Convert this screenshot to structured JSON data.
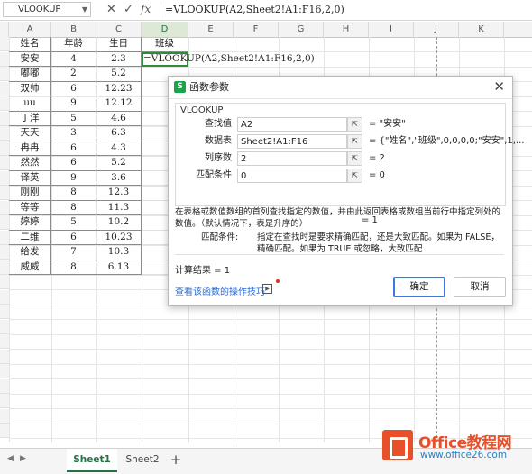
{
  "formula_bar": {
    "name_box": "VLOOKUP",
    "cancel_icon": "✕",
    "accept_icon": "✓",
    "fx_label": "fx",
    "formula": "=VLOOKUP(A2,Sheet2!A1:F16,2,0)"
  },
  "columns": [
    "A",
    "B",
    "C",
    "D",
    "E",
    "F",
    "G",
    "H",
    "I",
    "J",
    "K"
  ],
  "sheet_rows": [
    [
      "姓名",
      "年龄",
      "生日",
      "班级"
    ],
    [
      "安安",
      "4",
      "2.3",
      "=VLOOKUP(A2,Sheet2!A1:F16,2,0)"
    ],
    [
      "嘟嘟",
      "2",
      "5.2",
      ""
    ],
    [
      "双帅",
      "6",
      "12.23",
      ""
    ],
    [
      "uu",
      "9",
      "12.12",
      ""
    ],
    [
      "丁洋",
      "5",
      "4.6",
      ""
    ],
    [
      "天天",
      "3",
      "6.3",
      ""
    ],
    [
      "冉冉",
      "6",
      "4.3",
      ""
    ],
    [
      "然然",
      "6",
      "5.2",
      ""
    ],
    [
      "译英",
      "9",
      "3.6",
      ""
    ],
    [
      "刚刚",
      "8",
      "12.3",
      ""
    ],
    [
      "等等",
      "8",
      "11.3",
      ""
    ],
    [
      "婷婷",
      "5",
      "10.2",
      ""
    ],
    [
      "二维",
      "6",
      "10.23",
      ""
    ],
    [
      "给发",
      "7",
      "10.3",
      ""
    ],
    [
      "威威",
      "8",
      "6.13",
      ""
    ]
  ],
  "dialog": {
    "title": "函数参数",
    "logo": "S",
    "close_icon": "✕",
    "group_label": "VLOOKUP",
    "params": [
      {
        "label": "查找值",
        "value": "A2",
        "result": "= \"安安\""
      },
      {
        "label": "数据表",
        "value": "Sheet2!A1:F16",
        "result": "= {\"姓名\",\"班级\",0,0,0,0;\"安安\",1,..."
      },
      {
        "label": "列序数",
        "value": "2",
        "result": "= 2"
      },
      {
        "label": "匹配条件",
        "value": "0",
        "result": "= 0"
      }
    ],
    "total_result": "= 1",
    "description": "在表格或数值数组的首列查找指定的数值，并由此返回表格或数组当前行中指定列处的数值。（默认情况下，表是升序的）",
    "param_help_label": "匹配条件:",
    "param_help_text": "指定在查找时是要求精确匹配，还是大致匹配。如果为 FALSE，精确匹配。如果为 TRUE 或忽略，大致匹配",
    "calc_result": "计算结果 = 1",
    "help_link": "查看该函数的操作技巧",
    "ok_label": "确定",
    "cancel_label": "取消"
  },
  "sheet_tabs": {
    "tabs": [
      "Sheet1",
      "Sheet2"
    ],
    "active": "Sheet1",
    "add_icon": "+",
    "nav_left": "◀",
    "nav_right": "▶"
  },
  "watermark": {
    "brand": "Office教程网",
    "url": "www.office26.com"
  },
  "colors": {
    "accent_green": "#217346",
    "active_cell_border": "#2e8b3d",
    "primary_button_border": "#3b78d8",
    "link": "#2a6ad0",
    "watermark_orange": "#e8502a",
    "watermark_blue": "#2a7fc0"
  }
}
